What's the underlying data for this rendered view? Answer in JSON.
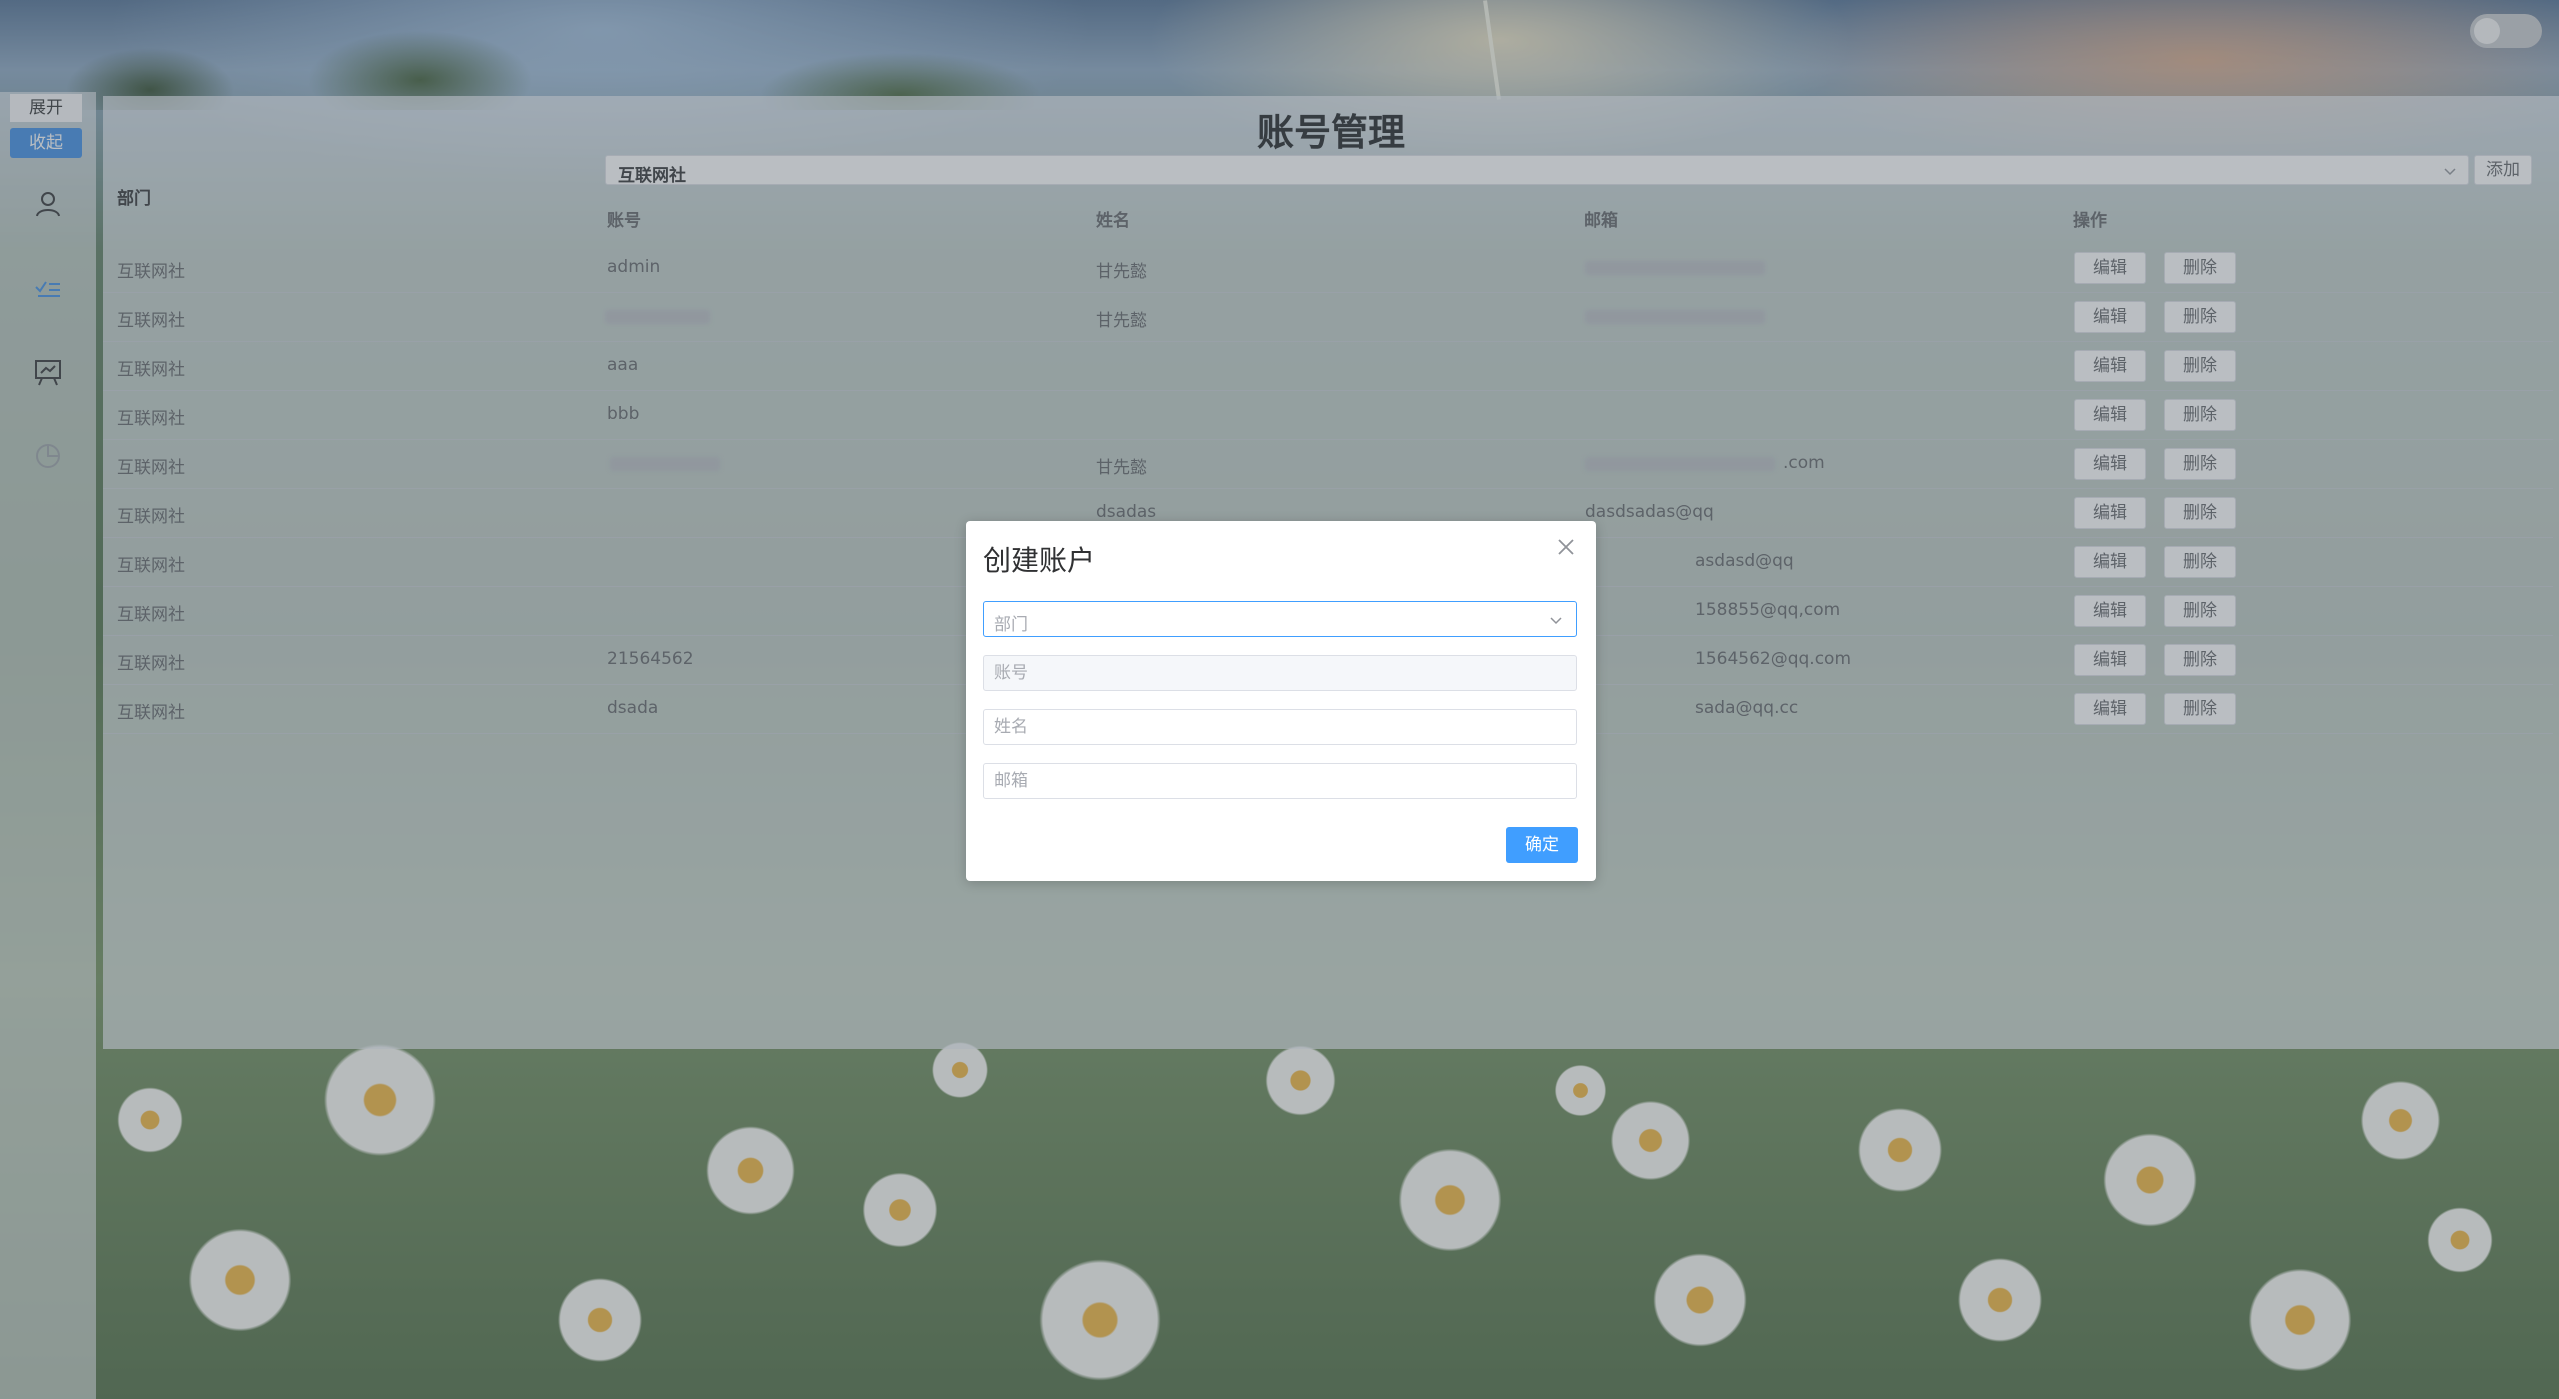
{
  "page": {
    "title": "账号管理"
  },
  "sidebar": {
    "expand_label": "展开",
    "collapse_label": "收起",
    "icons": [
      "user-icon",
      "checklist-icon",
      "presentation-icon",
      "pie-chart-icon"
    ]
  },
  "filter": {
    "dept_label": "部门",
    "dept_value": "互联网社",
    "add_label": "添加"
  },
  "table": {
    "headers": {
      "account": "账号",
      "name": "姓名",
      "email": "邮箱",
      "actions": "操作"
    },
    "edit_label": "编辑",
    "delete_label": "删除",
    "rows": [
      {
        "dept": "互联网社",
        "account": "admin",
        "name": "甘先懿",
        "email": ""
      },
      {
        "dept": "互联网社",
        "account": "",
        "name": "甘先懿",
        "email": ""
      },
      {
        "dept": "互联网社",
        "account": "aaa",
        "name": "",
        "email": ""
      },
      {
        "dept": "互联网社",
        "account": "bbb",
        "name": "",
        "email": ""
      },
      {
        "dept": "互联网社",
        "account": "",
        "name": "甘先懿",
        "email": ".com"
      },
      {
        "dept": "互联网社",
        "account": "",
        "name": "dsadas",
        "email": "dasdsadas@qq"
      },
      {
        "dept": "互联网社",
        "account": "",
        "name": "",
        "email": "asdasd@qq"
      },
      {
        "dept": "互联网社",
        "account": "",
        "name": "",
        "email": "158855@qq,com"
      },
      {
        "dept": "互联网社",
        "account": "21564562",
        "name": "",
        "email": "1564562@qq.com"
      },
      {
        "dept": "互联网社",
        "account": "dsada",
        "name": "",
        "email": "sada@qq.cc"
      }
    ]
  },
  "modal": {
    "title": "创建账户",
    "dept_placeholder": "部门",
    "account_placeholder": "账号",
    "name_placeholder": "姓名",
    "email_placeholder": "邮箱",
    "confirm_label": "确定"
  },
  "colors": {
    "primary": "#409eff",
    "sidebar_active": "#3c8ce6"
  }
}
